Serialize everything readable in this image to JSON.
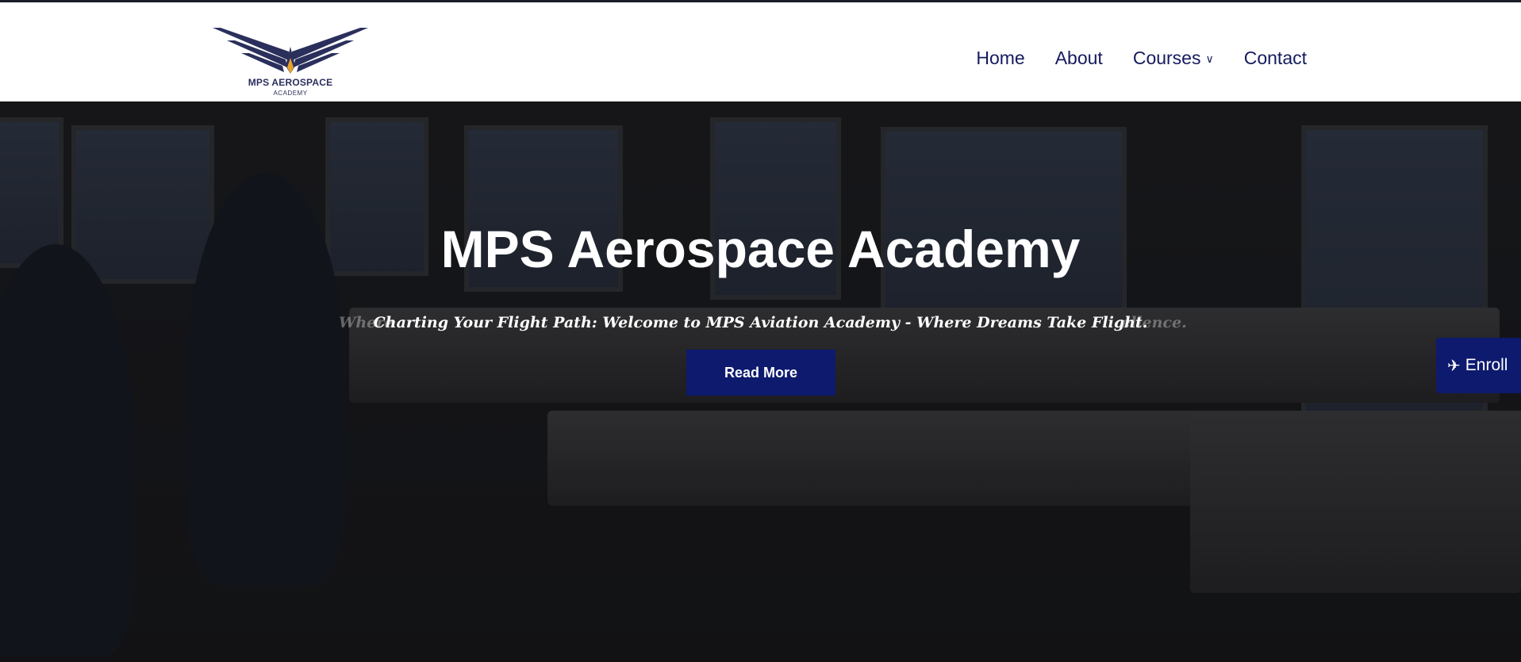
{
  "logo": {
    "brand": "MPS AEROSPACE",
    "brand_sub": "ACADEMY",
    "icon": "winged-emblem-icon",
    "colors": {
      "wing": "#2b2f5c",
      "flame": "#e6a22c"
    }
  },
  "nav": {
    "items": [
      {
        "label": "Home"
      },
      {
        "label": "About"
      },
      {
        "label": "Courses",
        "has_dropdown": true,
        "dropdown_icon": "chevron-down-icon"
      },
      {
        "label": "Contact"
      }
    ]
  },
  "hero": {
    "title": "MPS Aerospace Academy",
    "tagline": "Charting Your Flight Path: Welcome to MPS Aviation Academy - Where Dreams Take Flight.",
    "ghost_left": "Where",
    "ghost_right": "ellence.",
    "cta_label": "Read More"
  },
  "enroll": {
    "label": "Enroll",
    "icon": "plane-icon"
  },
  "colors": {
    "accent": "#0d1a6e",
    "nav_text": "#141b5e",
    "header_bg": "#ffffff"
  }
}
